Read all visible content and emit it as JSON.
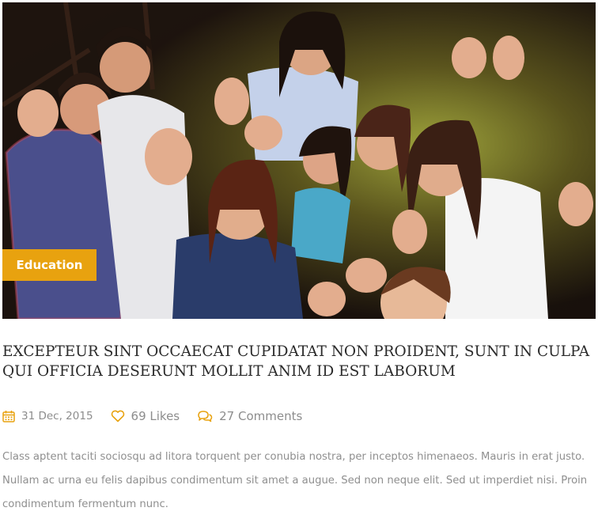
{
  "post": {
    "image_alt": "Group of young people smiling and waving at the camera",
    "category": "Education",
    "title": "EXCEPTEUR SINT OCCAECAT CUPIDATAT NON PROIDENT, SUNT IN CULPA QUI OFFICIA DESERUNT MOLLIT ANIM ID EST LABORUM",
    "meta": {
      "date": "31 Dec, 2015",
      "likes": "69 Likes",
      "comments": "27 Comments"
    },
    "excerpt": "Class aptent taciti sociosqu ad litora torquent per conubia nostra, per inceptos himenaeos. Mauris in erat justo. Nullam ac urna eu felis dapibus condimentum sit amet a augue. Sed non neque elit. Sed ut imperdiet nisi. Proin condimentum fermentum nunc."
  },
  "icons": {
    "date": "calendar-icon",
    "likes": "heart-icon",
    "comments": "comments-icon"
  },
  "colors": {
    "accent": "#e8a20f",
    "title": "#2b2b2b",
    "meta_text": "#8d8d8d",
    "excerpt_text": "#8f8f8f"
  }
}
